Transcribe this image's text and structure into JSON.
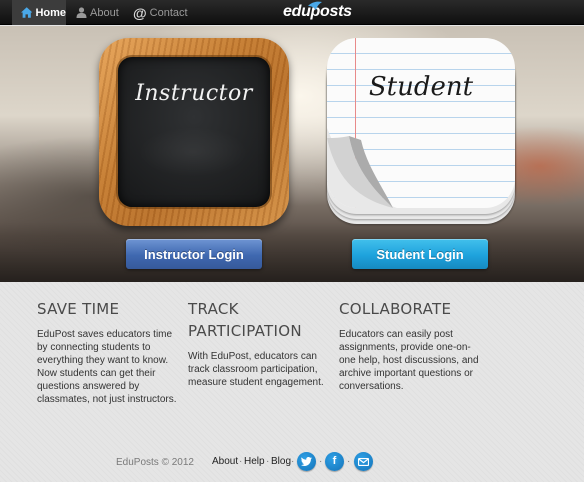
{
  "nav": {
    "home_label": "Home",
    "about_label": "About",
    "contact_label": "Contact",
    "logo_text": "eduposts"
  },
  "hero": {
    "instructor_tile_text": "Instructor",
    "student_tile_text": "Student",
    "instructor_button": "Instructor Login",
    "student_button": "Student Login"
  },
  "features": [
    {
      "title": "SAVE TIME",
      "body": "EduPost saves educators time by connecting students to everything they want to know. Now students can get their questions answered by classmates, not just instructors."
    },
    {
      "title": "TRACK PARTICIPATION",
      "body": "With EduPost, educators can track classroom participation, measure student engagement."
    },
    {
      "title": "COLLABORATE",
      "body": "Educators can easily post assignments, provide one-on-one help, host discussions, and archive important questions or conversations."
    }
  ],
  "footer": {
    "copyright": "EduPosts © 2012",
    "links": [
      "About",
      "Help",
      "Blog"
    ],
    "separator": "·"
  },
  "colors": {
    "instructor_button": "#3f68b0",
    "student_button": "#1ea2dc",
    "social_icon": "#1f8ad0"
  },
  "icons": [
    "home-icon",
    "user-icon",
    "at-icon",
    "twitter-icon",
    "facebook-icon",
    "email-icon"
  ]
}
